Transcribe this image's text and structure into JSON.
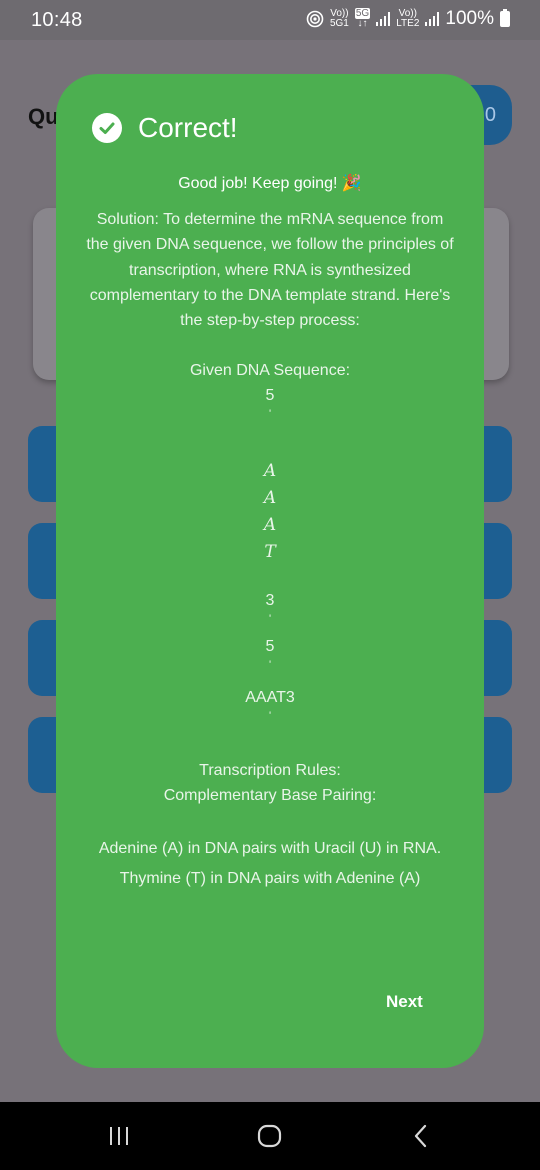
{
  "status_bar": {
    "time": "10:48",
    "battery": "100%",
    "volte1_top": "Vo))",
    "volte1_bottom": "5G1",
    "net_5g": "5G",
    "volte2_top": "Vo))",
    "volte2_bottom": "LTE2"
  },
  "background": {
    "title": "Qu",
    "score": "0"
  },
  "dialog": {
    "title": "Correct!",
    "icon": "check-circle-icon",
    "bg_color": "#4caf50",
    "message": "Good job! Keep going! 🎉",
    "solution_text": "Solution: To determine the mRNA sequence from the given DNA sequence, we follow the principles of transcription, where RNA is synthesized complementary to the DNA template strand. Here's the step-by-step process:",
    "given_heading": "Given DNA Sequence:",
    "seq_5": "5",
    "prime": "'",
    "bases": [
      "A",
      "A",
      "A",
      "T"
    ],
    "seq_3": "3",
    "seq_5b": "5",
    "aaat3": "AAAT3",
    "rules_heading": "Transcription Rules:",
    "pairing_heading": "Complementary Base Pairing:",
    "rule1": "Adenine (A) in DNA pairs with Uracil (U) in RNA.",
    "rule2": "Thymine (T) in DNA pairs with Adenine (A)",
    "next_label": "Next"
  },
  "nav": {
    "recents": "recents-icon",
    "home": "home-icon",
    "back": "back-icon"
  }
}
